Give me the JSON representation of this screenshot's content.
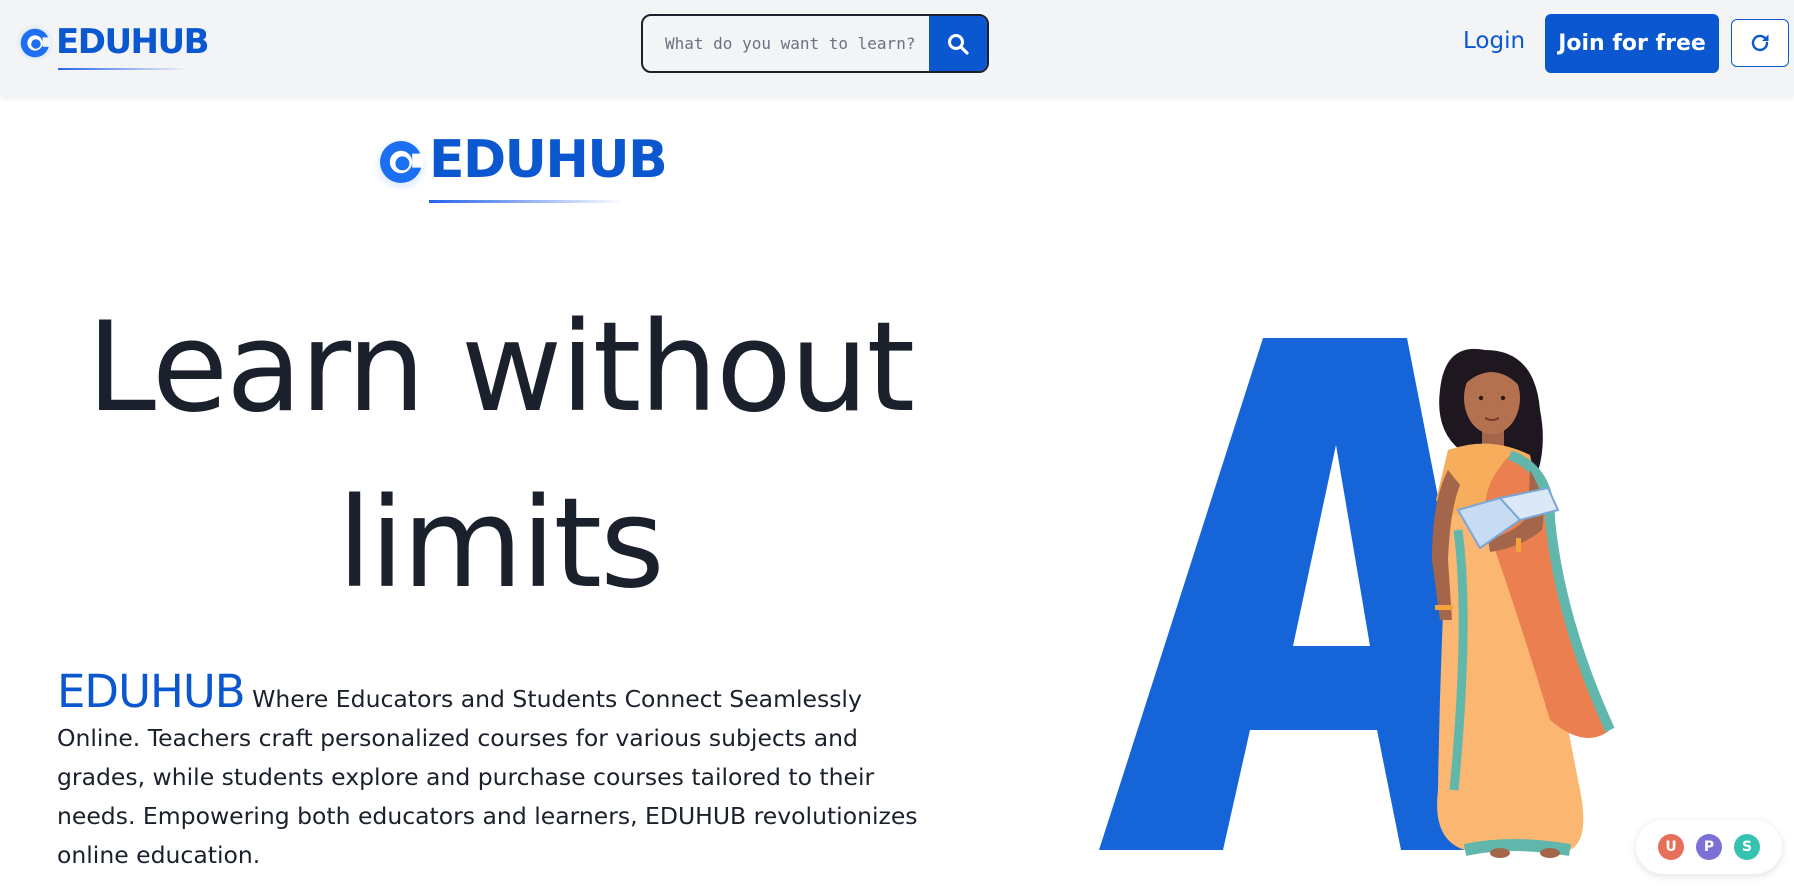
{
  "brand": {
    "name": "EDUHUB",
    "accent": "#0b57d0"
  },
  "header": {
    "search_placeholder": "What do you want to learn?",
    "login_label": "Login",
    "join_label": "Join for free"
  },
  "hero": {
    "headline_line1": "Learn without",
    "headline_line2": "limits",
    "about_brand": "EDUHUB",
    "about_text": " Where Educators and Students Connect Seamlessly Online. Teachers craft personalized courses for various subjects and grades, while students explore and purchase courses tailored to their needs. Empowering both educators and learners, EDUHUB revolutionizes online education."
  },
  "presence_avatars": [
    {
      "initial": "U",
      "color": "#e86f5a"
    },
    {
      "initial": "P",
      "color": "#7c6fd6"
    },
    {
      "initial": "S",
      "color": "#35c2b0"
    }
  ]
}
